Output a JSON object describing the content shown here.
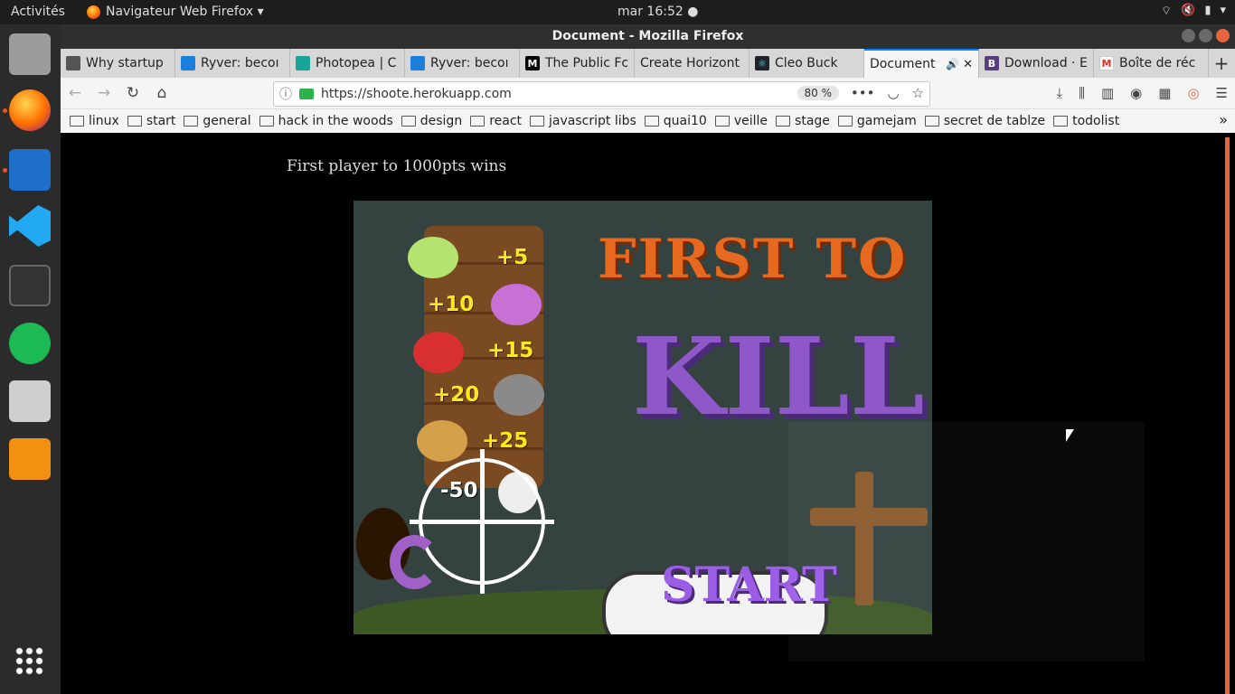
{
  "topbar": {
    "activities": "Activités",
    "app_menu": "Navigateur Web Firefox ▾",
    "clock": "mar 16:52 ●"
  },
  "window": {
    "title": "Document - Mozilla Firefox"
  },
  "tabs": [
    {
      "label": "Why startup",
      "icon_color": "#555555"
    },
    {
      "label": "Ryver: becoı",
      "icon_color": "#1b7ed8"
    },
    {
      "label": "Photopea | C",
      "icon_color": "#18a497"
    },
    {
      "label": "Ryver: becoı",
      "icon_color": "#1b7ed8"
    },
    {
      "label": "The Public Fc",
      "icon_color": "#000000"
    },
    {
      "label": "Create Horizont",
      "icon_color": "#d7d7d7"
    },
    {
      "label": "Cleo Buck",
      "icon_color": "#61dafb"
    },
    {
      "label": "Document",
      "icon_color": "#f5f5f5"
    },
    {
      "label": "Download · E",
      "icon_color": "#563d7c"
    },
    {
      "label": "Boîte de réc",
      "icon_color": "#d93025"
    }
  ],
  "navbar": {
    "url": "https://shoote.herokuapp.com",
    "zoom": "80 %"
  },
  "bookmarks": [
    "linux",
    "start",
    "general",
    "hack in the woods",
    "design",
    "react",
    "javascript libs",
    "quai10",
    "veille",
    "stage",
    "gamejam",
    "secret de tablze",
    "todolist"
  ],
  "page": {
    "heading": "First player to 1000pts wins"
  },
  "game": {
    "scores": [
      "+5",
      "+10",
      "+15",
      "+20",
      "+25",
      "-50"
    ],
    "title_line1": "FIRST TO",
    "title_line2": "KILL",
    "start_label": "START"
  }
}
